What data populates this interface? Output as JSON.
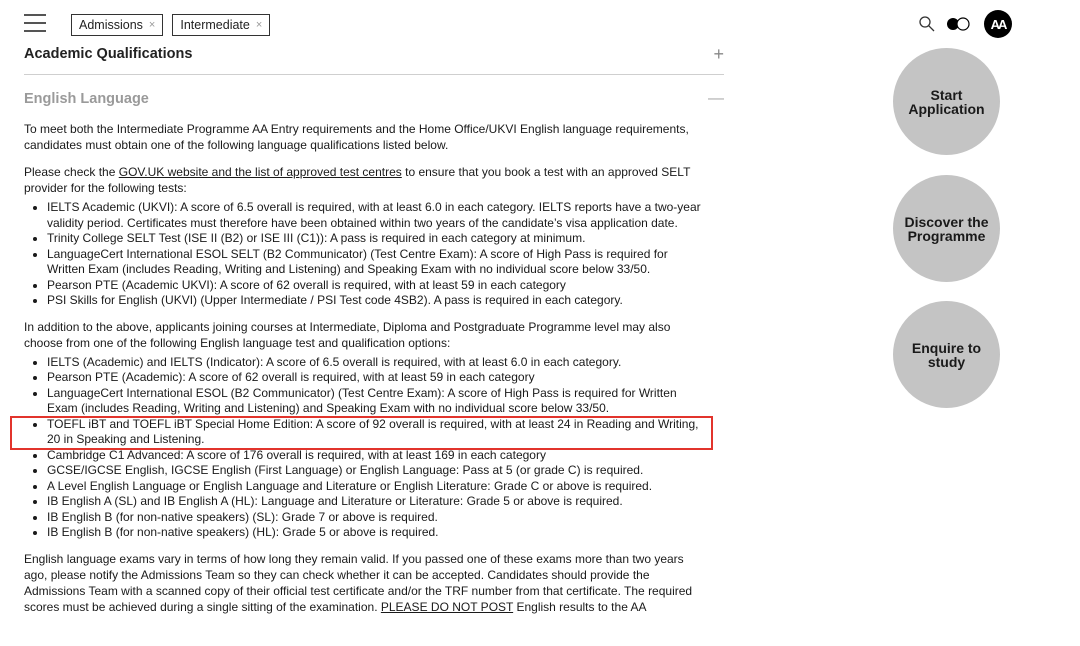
{
  "header": {
    "chips": [
      {
        "label": "Admissions"
      },
      {
        "label": "Intermediate"
      }
    ],
    "chip_remove_glyph": "×",
    "logo_text": "AA"
  },
  "section": {
    "title": "Academic Qualifications",
    "toggle": "+",
    "subsection": {
      "title": "English Language",
      "toggle": "—"
    }
  },
  "content": {
    "intro": "To meet both the Intermediate Programme AA Entry requirements and the Home Office/UKVI English language requirements, candidates must obtain one of the following language qualifications listed below.",
    "check_before": "Please check the ",
    "check_link": "GOV.UK website and the list of approved test centres",
    "check_after": " to ensure that you book a test with an approved SELT provider for the following tests:",
    "selt_tests": [
      "IELTS Academic (UKVI): A score of 6.5 overall is required, with at least 6.0 in each category. IELTS reports have a two-year validity period. Certificates must therefore have been obtained within two years of the candidate’s visa application date.",
      "Trinity College SELT Test (ISE II (B2) or ISE III (C1)): A pass is required in each category at minimum.",
      "LanguageCert International ESOL SELT (B2 Communicator) (Test Centre Exam): A score of High Pass is required for Written Exam (includes Reading, Writing and Listening) and Speaking Exam with no individual score below 33/50.",
      "Pearson PTE (Academic UKVI): A score of 62 overall is required, with at least 59 in each category",
      "PSI Skills for English (UKVI) (Upper Intermediate / PSI Test code 4SB2). A pass is required in each category."
    ],
    "additional_intro": "In addition to the above, applicants joining courses at Intermediate, Diploma and Postgraduate Programme level may also choose from one of the following English language test and qualification options:",
    "additional_tests": [
      "IELTS (Academic) and IELTS (Indicator): A score of 6.5 overall is required, with at least 6.0 in each category.",
      "Pearson PTE (Academic): A score of 62 overall is required, with at least 59 in each category",
      "LanguageCert International ESOL (B2 Communicator) (Test Centre Exam): A score of High Pass is required for Written Exam (includes Reading, Writing and Listening) and Speaking Exam with no individual score below 33/50.",
      "TOEFL iBT and TOEFL iBT Special Home Edition: A score of 92 overall is required, with at least 24 in Reading and Writing, 20 in Speaking and Listening.",
      "Cambridge C1 Advanced: A score of 176 overall is required, with at least 169 in each category",
      "GCSE/IGCSE English, IGCSE English (First Language) or English Language: Pass at 5 (or grade C) is required.",
      "A Level English Language or English Language and Literature or English Literature: Grade C or above is required.",
      "IB English A (SL) and IB English A (HL): Language and Literature or Literature: Grade 5 or above is required.",
      "IB English B (for non-native speakers) (SL): Grade 7 or above is required.",
      "IB English B (for non-native speakers) (HL): Grade 5 or above is required."
    ],
    "validity_before": "English language exams vary in terms of how long they remain valid. If you passed one of these exams more than two years ago, please notify the Admissions Team so they can check whether it can be accepted. Candidates should provide the Admissions Team with a scanned copy of their official test certificate and/or the TRF number from that certificate. The required scores must be achieved during a single sitting of the examination. ",
    "validity_emphasis": "PLEASE DO NOT POST",
    "validity_after": " English results to the AA"
  },
  "sidebar": {
    "start_label_1": "Start",
    "start_label_2": "Application",
    "discover_label_1": "Discover the",
    "discover_label_2": "Programme",
    "enquire_label_1": "Enquire to",
    "enquire_label_2": "study"
  },
  "colors": {
    "highlight": "#e2342c",
    "cta_bg": "#c4c4c4"
  }
}
